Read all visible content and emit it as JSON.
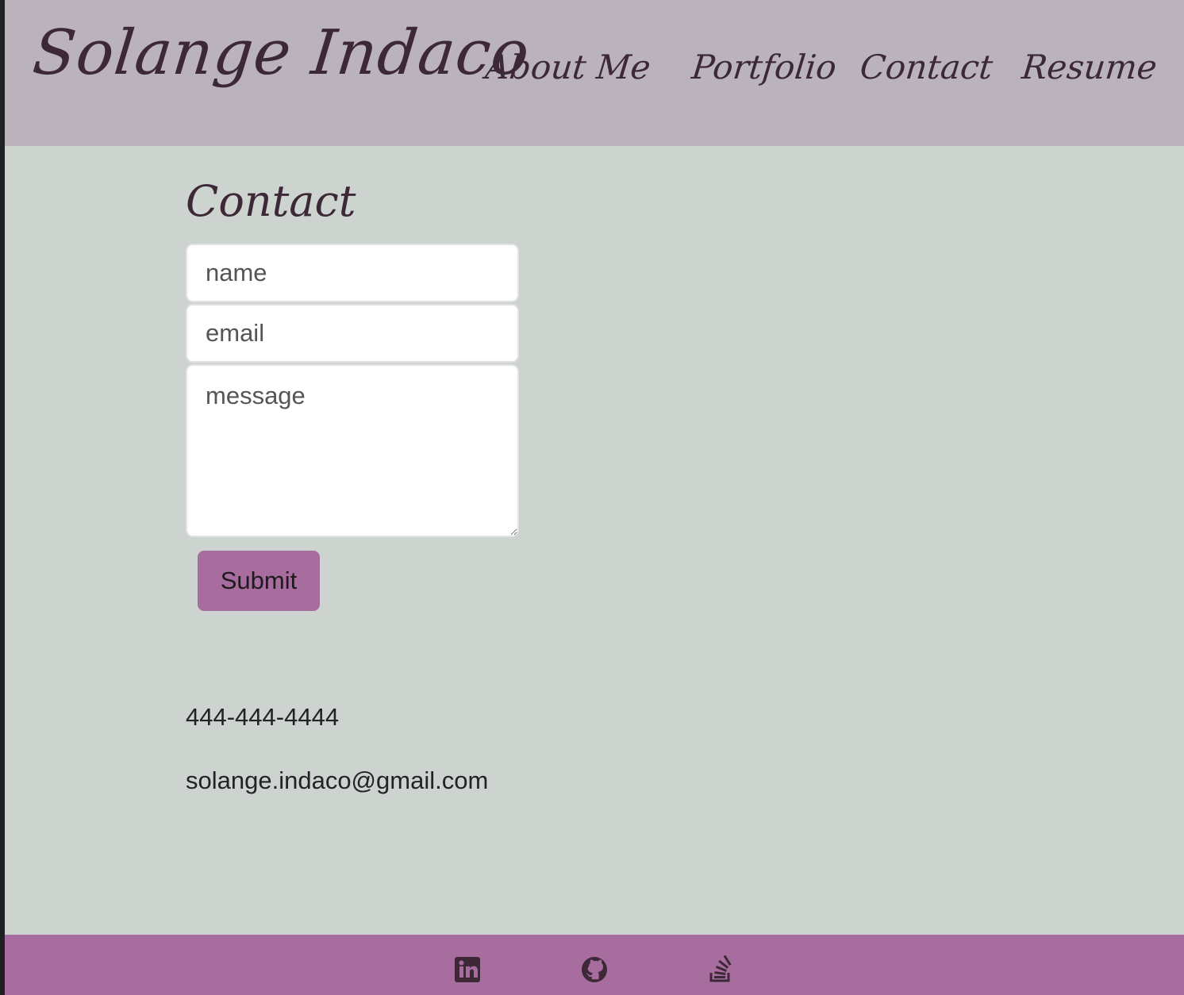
{
  "header": {
    "brand": "Solange Indaco",
    "nav": [
      "About Me",
      "Portfolio",
      "Contact",
      "Resume"
    ]
  },
  "contact": {
    "title": "Contact",
    "name_placeholder": "name",
    "email_placeholder": "email",
    "message_placeholder": "message",
    "submit_label": "Submit",
    "phone": "444-444-4444",
    "email": "solange.indaco@gmail.com"
  },
  "footer": {
    "icons": [
      "linkedin-icon",
      "github-icon",
      "stack-overflow-icon"
    ]
  },
  "colors": {
    "header_bg": "#bab3bc",
    "page_bg": "#cdd3cf",
    "accent": "#a86d9f",
    "text_dark": "#3c2836"
  }
}
